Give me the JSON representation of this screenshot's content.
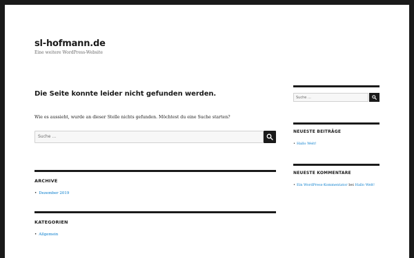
{
  "site": {
    "title": "sl-hofmann.de",
    "description": "Eine weitere WordPress-Website"
  },
  "main": {
    "heading": "Die Seite konnte leider nicht gefunden werden.",
    "message": "Wie es aussieht, wurde an dieser Stelle nichts gefunden. Möchtest du eine Suche starten?",
    "search_placeholder": "Suche …"
  },
  "widgets": {
    "archive": {
      "title": "ARCHIVE",
      "items": [
        "Dezember 2019"
      ]
    },
    "categories": {
      "title": "KATEGORIEN",
      "items": [
        "Allgemein"
      ]
    }
  },
  "sidebar": {
    "search_placeholder": "Suche …",
    "recent_posts": {
      "title": "NEUESTE BEITRÄGE",
      "items": [
        "Hallo Welt!"
      ]
    },
    "recent_comments": {
      "title": "NEUESTE KOMMENTARE",
      "author": "Ein WordPress-Kommentator",
      "joiner": "bei",
      "post": "Hallo Welt!"
    }
  },
  "colors": {
    "link": "#007acc",
    "text": "#1a1a1a",
    "frame": "#1a1a1a"
  },
  "icons": [
    "search-icon"
  ]
}
